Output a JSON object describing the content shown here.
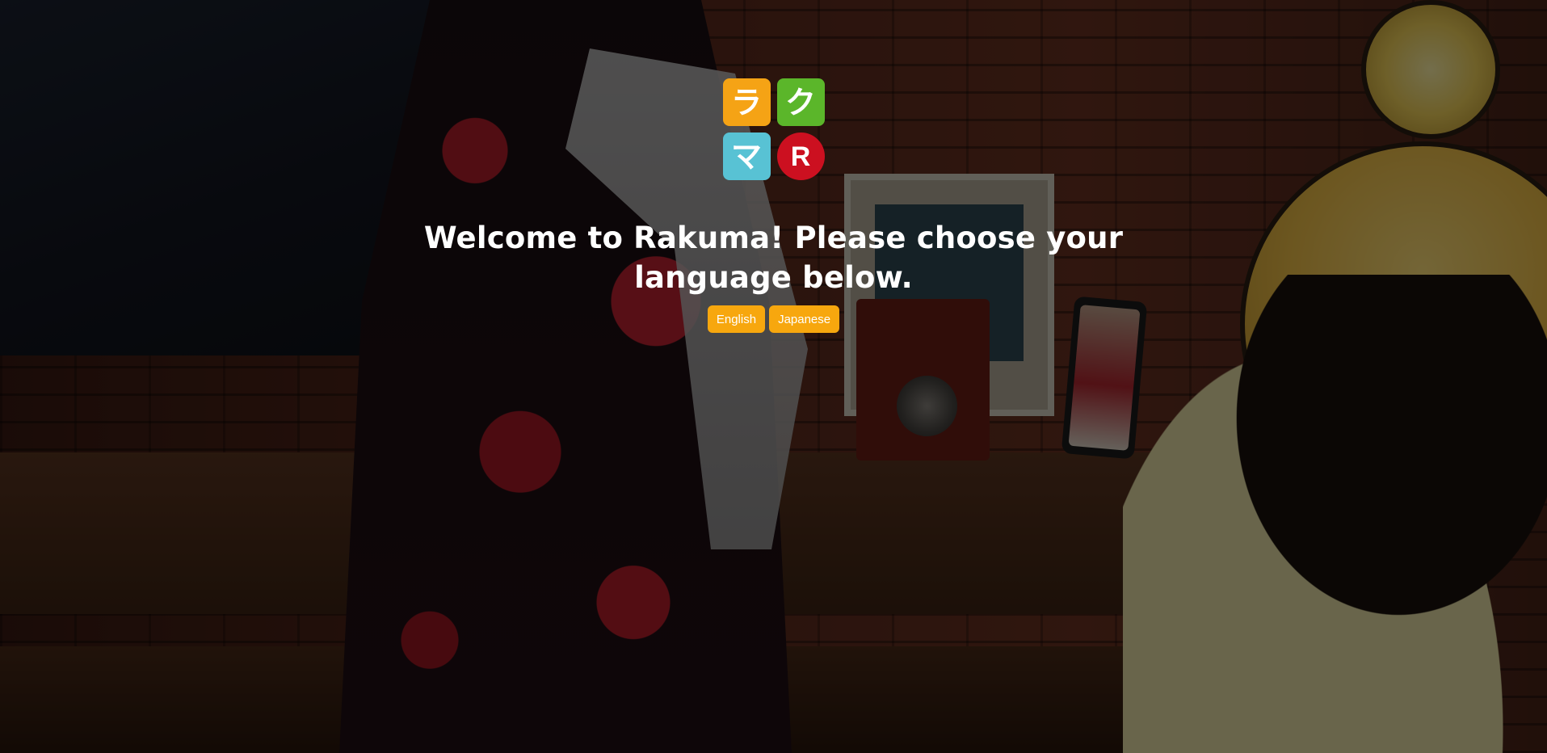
{
  "background": {
    "description_icon": "photo-background",
    "overlay_color": "#000000"
  },
  "logo": {
    "tiles": [
      {
        "glyph": "ラ",
        "color": "#f5a315",
        "icon": "ra-tile"
      },
      {
        "glyph": "ク",
        "color": "#5bb62a",
        "icon": "ku-tile"
      },
      {
        "glyph": "マ",
        "color": "#58c2d4",
        "icon": "ma-tile"
      },
      {
        "glyph": "R",
        "color": "#cc1020",
        "icon": "rakuten-r-tile"
      }
    ]
  },
  "welcome": {
    "message": "Welcome to Rakuma! Please choose your language below."
  },
  "languages": {
    "english_label": "English",
    "japanese_label": "Japanese",
    "button_color": "#f7a70e"
  }
}
